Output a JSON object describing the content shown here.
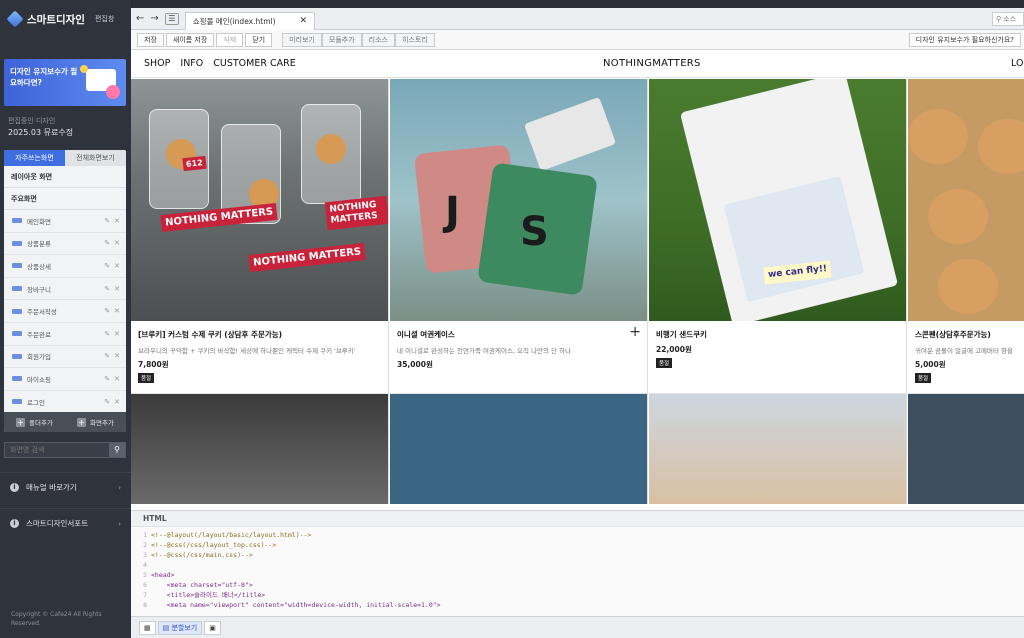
{
  "sidebar": {
    "brand": "스마트디자인",
    "brand_sub": "편집창",
    "promo": "디자인 유지보수가 필요하다면?",
    "plan_label": "편집중인 디자인",
    "plan_value": "2025.03 뮤료수정",
    "tabs": [
      "자주쓰는화면",
      "전체화면보기"
    ],
    "layout_label": "레이아웃 화면",
    "main_label": "주요화면",
    "pages": [
      "메인화면",
      "상품분류",
      "상품상세",
      "장바구니",
      "주문서작성",
      "주문완료",
      "회원가입",
      "마이쇼핑",
      "로그인"
    ],
    "add_folder": "폴더추가",
    "add_screen": "화면추가",
    "search_placeholder": "화면명 검색",
    "links": [
      "매뉴얼 바로가기",
      "스마트디자인서포트"
    ],
    "copyright": "Copyright © Cafe24 All Rights Reserved."
  },
  "editor": {
    "file_tab": "쇼핑몰 메인(index.html)",
    "search_placeholder": "소스",
    "toolbar": {
      "save": "저장",
      "save_as": "새이름 저장",
      "delete": "삭제",
      "close": "닫기",
      "preview": "미리보기",
      "module_add": "모듈추가",
      "resource": "리소스",
      "history": "히스토리",
      "maintenance": "디자인 유지보수가 필요하신가요?"
    }
  },
  "site": {
    "menu": [
      "SHOP",
      "INFO",
      "CUSTOMER CARE"
    ],
    "logo": "NOTHINGMATTERS",
    "login": "LO",
    "products": [
      {
        "name": "[브루키] 커스텀 수제 쿠키 (상담후 주문가능)",
        "desc": "브라우니의 꾸덕함 + 쿠키의 바삭함! 세상에 하나뿐인 캐릭터 수제 쿠키 '브루키'",
        "price": "7,800원",
        "badge": "품절"
      },
      {
        "name": "이니셜 여권케이스",
        "desc": "내 이니셜로 완성하는 천연가죽 여권케이스, 오직 나만의 단 하나",
        "price": "35,000원",
        "badge": ""
      },
      {
        "name": "비행기 샌드쿠키",
        "desc": "",
        "price": "22,000원",
        "badge": "품절"
      },
      {
        "name": "스콘펜(상담후주문가능)",
        "desc": "귀여운 곰돌이 얼굴에 고메버터 향을",
        "price": "5,000원",
        "badge": "품절"
      }
    ],
    "image_text": {
      "sign": "NOTHING MATTERS",
      "sign_number": "612",
      "initials": [
        "J",
        "S"
      ],
      "tray_text": "we can fly!!"
    }
  },
  "code_panel": {
    "title": "HTML",
    "lines": [
      {
        "n": "1",
        "t": "<!--@layout(/layout/basic/layout.html)-->"
      },
      {
        "n": "2",
        "t": "<!--@css(/css/layout_top.css)-->"
      },
      {
        "n": "3",
        "t": "<!--@css(/css/main.css)-->"
      },
      {
        "n": "4",
        "t": ""
      },
      {
        "n": "5",
        "t": "<head>"
      },
      {
        "n": "6",
        "t": "    <meta charset=\"utf-8\">"
      },
      {
        "n": "7",
        "t": "    <title>슬라이드 배너</title>"
      },
      {
        "n": "8",
        "t": "    <meta name=\"viewport\" content=\"width=device-width, initial-scale=1.0\">"
      }
    ]
  },
  "bottom_tabs": [
    "분할보기"
  ]
}
